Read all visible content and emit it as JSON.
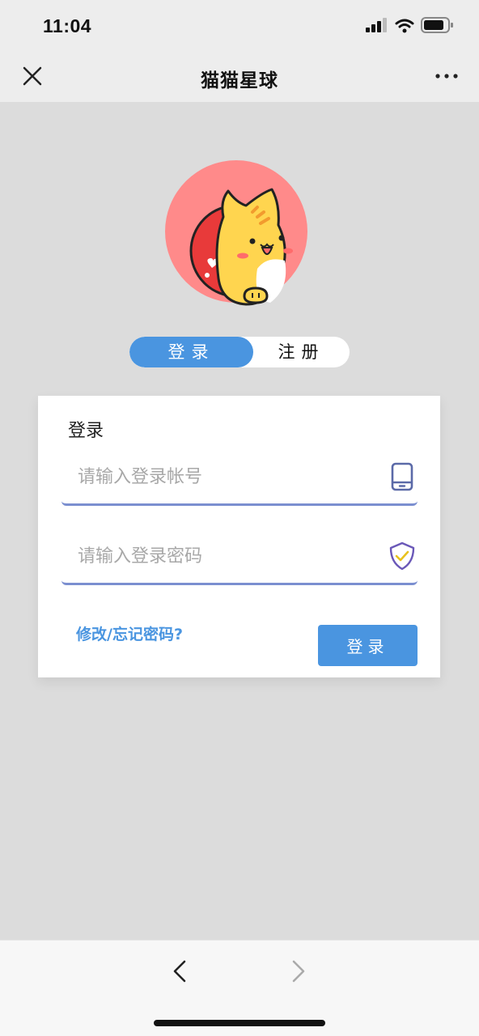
{
  "status_bar": {
    "time": "11:04",
    "icons": [
      "signal-icon",
      "wifi-icon",
      "battery-icon"
    ]
  },
  "nav": {
    "title": "猫猫星球",
    "close_icon": "close-icon",
    "more_icon": "more-icon"
  },
  "avatar": {
    "icon": "cat-avatar-icon",
    "colors": {
      "outer": "#ff8a8a",
      "inner": "#e83a3a",
      "cat": "#ffd54f"
    }
  },
  "tabs": [
    {
      "label": "登录",
      "active": true
    },
    {
      "label": "注册",
      "active": false
    }
  ],
  "login_card": {
    "title": "登录",
    "account_placeholder": "请输入登录帐号",
    "account_icon": "phone-icon",
    "password_placeholder": "请输入登录密码",
    "password_icon": "shield-check-icon",
    "forgot_link": "修改/忘记密码?",
    "submit_label": "登录"
  },
  "bottom_nav": {
    "back_icon": "chevron-left-icon",
    "forward_icon": "chevron-right-icon"
  },
  "colors": {
    "accent": "#4a95e0",
    "field_underline": "#7b8fd0",
    "background": "#dcdcdc"
  }
}
